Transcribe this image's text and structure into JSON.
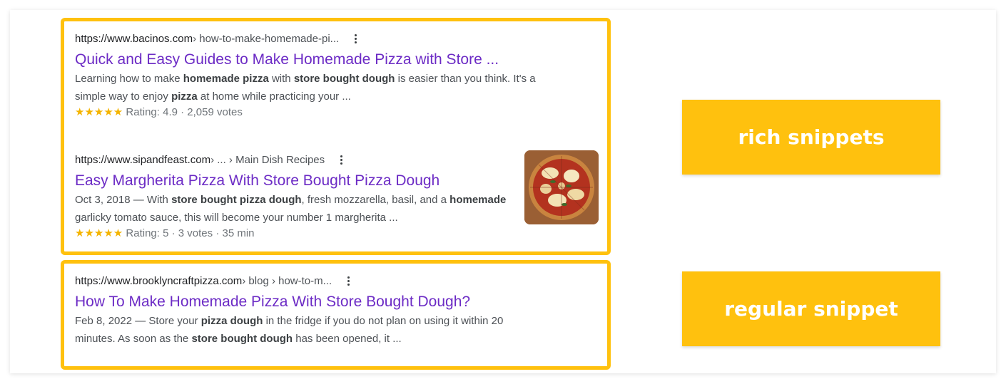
{
  "results": [
    {
      "url_base": "https://www.bacinos.com",
      "url_path": " › how-to-make-homemade-pi...",
      "title": "Quick and Easy Guides to Make Homemade Pizza with Store ...",
      "line1_a": "Learning how to make ",
      "line1_b": "homemade pizza",
      "line1_c": " with ",
      "line1_d": "store bought dough",
      "line1_e": " is easier than you think. It's a",
      "line2_a": "simple way to enjoy ",
      "line2_b": "pizza",
      "line2_c": " at home while practicing your ...",
      "stars": "★★★★★",
      "rating_text": " Rating: 4.9 · 2,059 votes"
    },
    {
      "url_base": "https://www.sipandfeast.com",
      "url_path": " › ... › Main Dish Recipes",
      "title": "Easy Margherita Pizza With Store Bought Pizza Dough",
      "line1_a": "Oct 3, 2018 — With ",
      "line1_b": "store bought pizza dough",
      "line1_c": ", fresh mozzarella, basil, and a ",
      "line1_d": "homemade",
      "line2_a": "garlicky tomato sauce, this will become your number 1 margherita ...",
      "stars": "★★★★★",
      "rating_text": " Rating: 5 · 3 votes · 35 min"
    },
    {
      "url_base": "https://www.brooklyncraftpizza.com",
      "url_path": " › blog › how-to-m...",
      "title": "How To Make Homemade Pizza With Store Bought Dough?",
      "line1_a": "Feb 8, 2022 — Store your ",
      "line1_b": "pizza dough",
      "line1_c": " in the fridge if you do not plan on using it within 20",
      "line2_a": "minutes. As soon as the ",
      "line2_b": "store bought dough",
      "line2_c": " has been opened, it ..."
    }
  ],
  "labels": {
    "rich": "rich snippets",
    "regular": "regular snippet"
  },
  "colors": {
    "accent": "#ffc10e",
    "title_link": "#6c2bc5",
    "star": "#f4b400"
  },
  "icons": {
    "menu": "more-vert-icon",
    "thumbnail": "pizza-thumbnail"
  }
}
